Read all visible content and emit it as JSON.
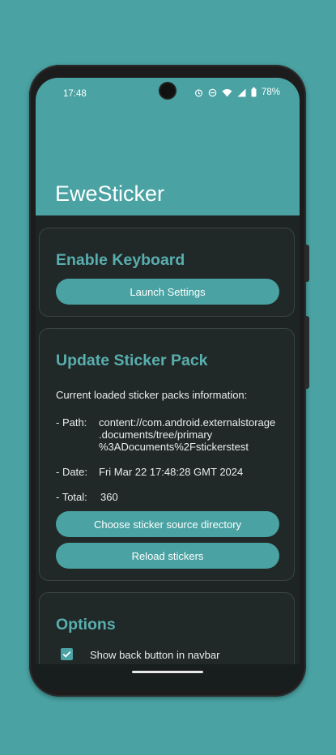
{
  "status_bar": {
    "time": "17:48",
    "battery": "78%",
    "icons": [
      "alarm-icon",
      "do-not-disturb-icon",
      "wifi-icon",
      "cell-signal-icon",
      "battery-icon"
    ]
  },
  "app_bar": {
    "title": "EweSticker"
  },
  "enable_keyboard": {
    "title": "Enable Keyboard",
    "button": "Launch Settings"
  },
  "update_sticker_pack": {
    "title": "Update Sticker Pack",
    "info_header": "Current loaded sticker packs information:",
    "path_label": "- Path:",
    "path_lines": [
      "content://com.android.externalstorage",
      ".documents/tree/primary",
      "%3ADocuments%2Fstickerstest"
    ],
    "date_label": "- Date:",
    "date_value": "Fri Mar 22 17:48:28 GMT 2024",
    "total_label": "- Total:",
    "total_value": "360",
    "choose_button": "Choose sticker source directory",
    "reload_button": "Reload stickers"
  },
  "options": {
    "title": "Options",
    "items": [
      {
        "label": "Show back button in navbar",
        "checked": true
      }
    ]
  },
  "colors": {
    "accent": "#4aa2a3",
    "title_accent": "#59aeae",
    "surface": "#212828",
    "background": "#1e2424"
  }
}
